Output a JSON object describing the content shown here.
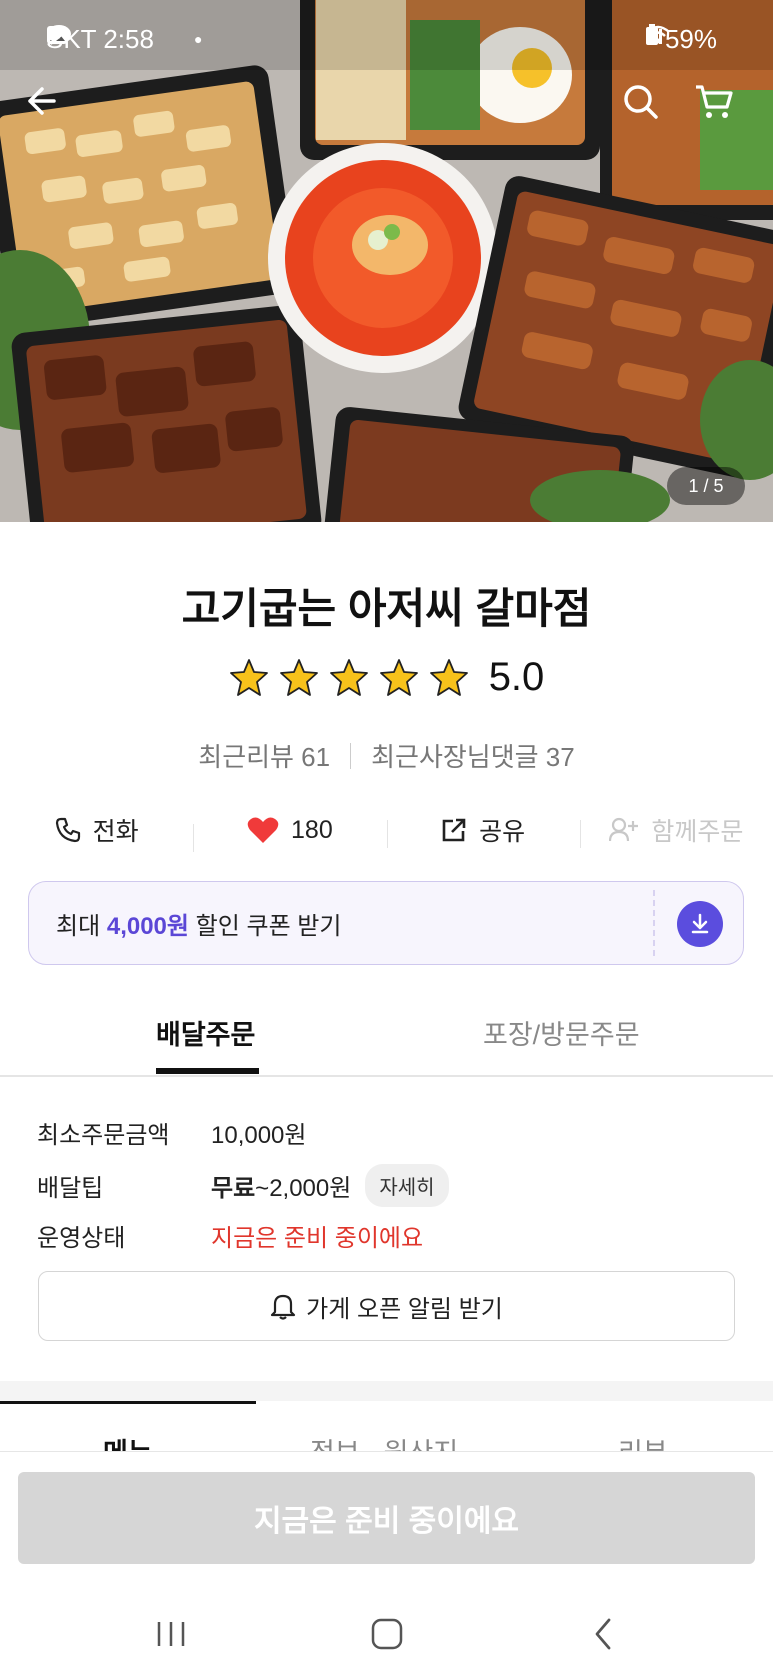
{
  "status_bar": {
    "carrier_time": "SKT 2:58",
    "battery": "59%"
  },
  "hero": {
    "page_indicator": "1 / 5"
  },
  "store": {
    "name": "고기굽는 아저씨 갈마점",
    "rating": "5.0",
    "rating_stars": 5,
    "recent_reviews": "최근리뷰 61",
    "owner_replies": "최근사장님댓글 37"
  },
  "actions": {
    "call": "전화",
    "likes": "180",
    "share": "공유",
    "group_order": "함께주문"
  },
  "coupon": {
    "prefix": "최대",
    "amount": "4,000원",
    "suffix": "할인 쿠폰 받기"
  },
  "order_tabs": {
    "delivery": "배달주문",
    "pickup": "포장/방문주문"
  },
  "delivery_info": {
    "min_order_label": "최소주문금액",
    "min_order_value": "10,000원",
    "tip_label": "배달팁",
    "tip_free": "무료",
    "tip_range": "~2,000원",
    "tip_detail": "자세히",
    "status_label": "운영상태",
    "status_value": "지금은 준비 중이에요"
  },
  "notify_button": "가게 오픈 알림 받기",
  "menu_tabs": {
    "menu": "메뉴",
    "info": "정보 · 원산지",
    "review": "리뷰"
  },
  "bottom_cta": "지금은 준비 중이에요",
  "colors": {
    "accent": "#5b4dde",
    "status_red": "#e0362c",
    "heart": "#f03a3a",
    "star": "#f7c21b"
  }
}
